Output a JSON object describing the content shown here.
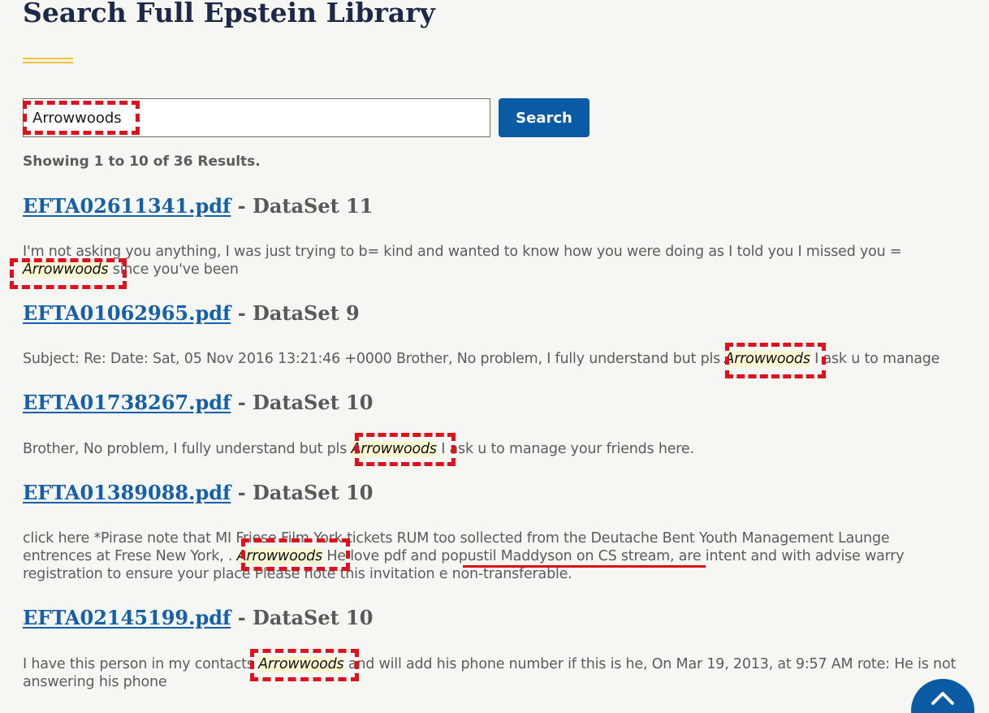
{
  "page": {
    "title": "Search Full Epstein Library"
  },
  "search": {
    "value": "Arrowwoods",
    "button_label": "Search"
  },
  "results_summary": "Showing 1 to 10 of 36 Results.",
  "results": [
    {
      "file": "EFTA02611341.pdf",
      "source": " - DataSet 11",
      "snippet_before": "I'm not asking you anything, I was just trying to b= kind and wanted to know how you were doing as I told you I missed you = ",
      "highlight": "Arrowwoods",
      "snippet_after": " since you've been"
    },
    {
      "file": "EFTA01062965.pdf",
      "source": " - DataSet 9",
      "snippet_before": "Subject: Re: Date: Sat, 05 Nov 2016 13:21:46 +0000 Brother, No problem, I fully understand but pls ",
      "highlight": "Arrowwoods",
      "snippet_after": " I ask u to manage"
    },
    {
      "file": "EFTA01738267.pdf",
      "source": " - DataSet 10",
      "snippet_before": "Brother, No problem, I fully understand but pls ",
      "highlight": "Arrowwoods",
      "snippet_after": " I ask u to manage your friends here."
    },
    {
      "file": "EFTA01389088.pdf",
      "source": " - DataSet 10",
      "snippet_before": "click here *Pirase note that MI Friese Film York tickets RUM too sollected from the Deutache Bent Youth Management Launge entrences at Frese New York, . ",
      "highlight": "Arrowwoods",
      "snippet_after": " He love pdf and popustil Maddyson on CS stream, are intent and with advise warry registration to ensure your place Please note this invitation e non-transferable."
    },
    {
      "file": "EFTA02145199.pdf",
      "source": " - DataSet 10",
      "snippet_before": "I have this person in my contacts ",
      "highlight": "Arrowwoods",
      "snippet_after": " and will add his phone number if this is he, On Mar 19, 2013, at 9:57 AM rote: He is not answering his phone"
    }
  ],
  "colors": {
    "page_background": "#f6f6f2",
    "title": "#1c2a48",
    "accent_rule": "#f2c33c",
    "link": "#1560a8",
    "button": "#0a5ba3",
    "highlight_background": "#fbf6d2",
    "annotation_red": "#e0111e"
  },
  "icons": {
    "back_to_top": "chevron-up-icon"
  }
}
